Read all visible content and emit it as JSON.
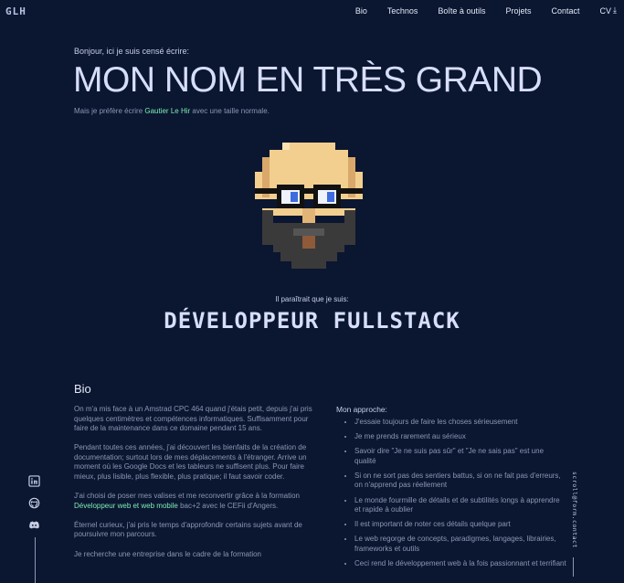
{
  "header": {
    "logo": "GLH",
    "nav": [
      "Bio",
      "Technos",
      "Boîte à outils",
      "Projets",
      "Contact"
    ],
    "cv": "CV",
    "cv_icon": "download-icon"
  },
  "hero": {
    "intro": "Bonjour, ici je suis censé écrire:",
    "big_name": "MON NOM EN TRÈS GRAND",
    "sub_before": "Mais je préfère écrire ",
    "sub_name": "Gautier Le Hir",
    "sub_after": " avec une taille normale.",
    "seems": "Il paraîtrait que je suis:",
    "role": "DÉVELOPPEUR FULLSTACK"
  },
  "bio": {
    "title": "Bio",
    "p1": "On m'a mis face à un Amstrad CPC 464 quand j'étais petit, depuis j'ai pris quelques centimètres et compétences informatiques. Suffisamment pour faire de la maintenance dans ce domaine pendant 15 ans.",
    "p2": "Pendant toutes ces années, j'ai découvert les bienfaits de la création de documentation; surtout lors de mes déplacements à l'étranger. Arrive un moment où les Google Docs et les tableurs ne suffisent plus. Pour faire mieux, plus lisible, plus flexible, plus pratique; il faut savoir coder.",
    "p3_before": "J'ai choisi de poser mes valises et me reconvertir grâce à la formation ",
    "p3_link": "Développeur web et web mobile",
    "p3_after": " bac+2 avec le CEFii d'Angers.",
    "p4": "Éternel curieux, j'ai pris le temps d'approfondir certains sujets avant de poursuivre mon parcours.",
    "p5": "Je recherche une entreprise dans le cadre de la formation"
  },
  "approach": {
    "title": "Mon approche:",
    "items": [
      "J'essaie toujours de faire les choses sérieusement",
      "Je me prends rarement au sérieux",
      "Savoir dire \"Je ne suis pas sûr\" et \"Je ne sais pas\" est une qualité",
      "Si on ne sort pas des sentiers battus, si on ne fait pas d'erreurs, on n'apprend pas réellement",
      "Le monde fourmille de détails et de subtilités longs à apprendre et rapide à oublier",
      "Il est important de noter ces détails quelque part",
      "Le web regorge de concepts, paradigmes, langages, librairies, frameworks et outils",
      "Ceci rend le développement web à la fois passionnant et terrifiant"
    ]
  },
  "social": [
    "linkedin-icon",
    "github-icon",
    "discord-icon"
  ],
  "email": "scroll@form.contact",
  "colors": {
    "background": "#0b1631",
    "accent": "#7ef0b4",
    "heading": "#d7def7"
  }
}
